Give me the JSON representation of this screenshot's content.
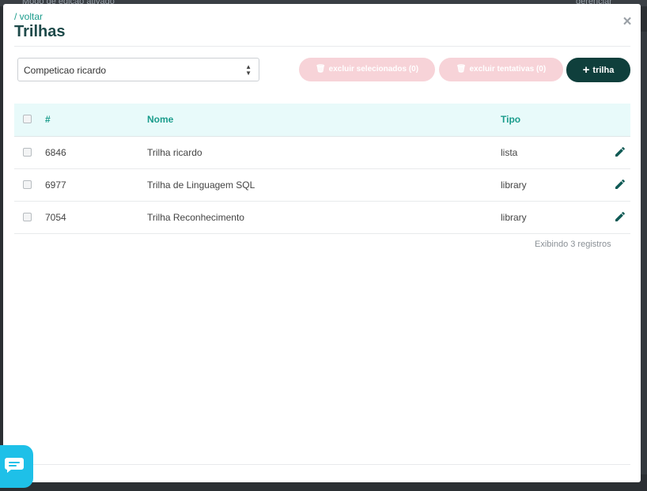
{
  "background": {
    "left_text": "Modo de edição ativado",
    "right_text": "gerenciar"
  },
  "header": {
    "back_label": "/ voltar",
    "title": "Trilhas",
    "close_glyph": "×"
  },
  "toolbar": {
    "selected_competition": "Competicao ricardo",
    "delete_selected_label": "excluir selecionados (0)",
    "delete_attempts_label": "excluir tentativas (0)",
    "new_trail_label": "trilha",
    "new_trail_icon": "plus-icon",
    "delete_icon": "trash-icon"
  },
  "table": {
    "columns": [
      "#",
      "Nome",
      "Tipo"
    ],
    "rows": [
      {
        "id": "6846",
        "name": "Trilha ricardo",
        "type": "lista"
      },
      {
        "id": "6977",
        "name": "Trilha de Linguagem SQL",
        "type": "library"
      },
      {
        "id": "7054",
        "name": "Trilha Reconhecimento",
        "type": "library"
      }
    ],
    "footer": "Exibindo 3 registros"
  },
  "colors": {
    "accent": "#1a9c8c",
    "title": "#1e4a4a",
    "primary_button": "#0f3f3c",
    "disabled_button": "#f7d3d8",
    "header_row": "#e8fafa",
    "chat": "#1ec0e8"
  }
}
